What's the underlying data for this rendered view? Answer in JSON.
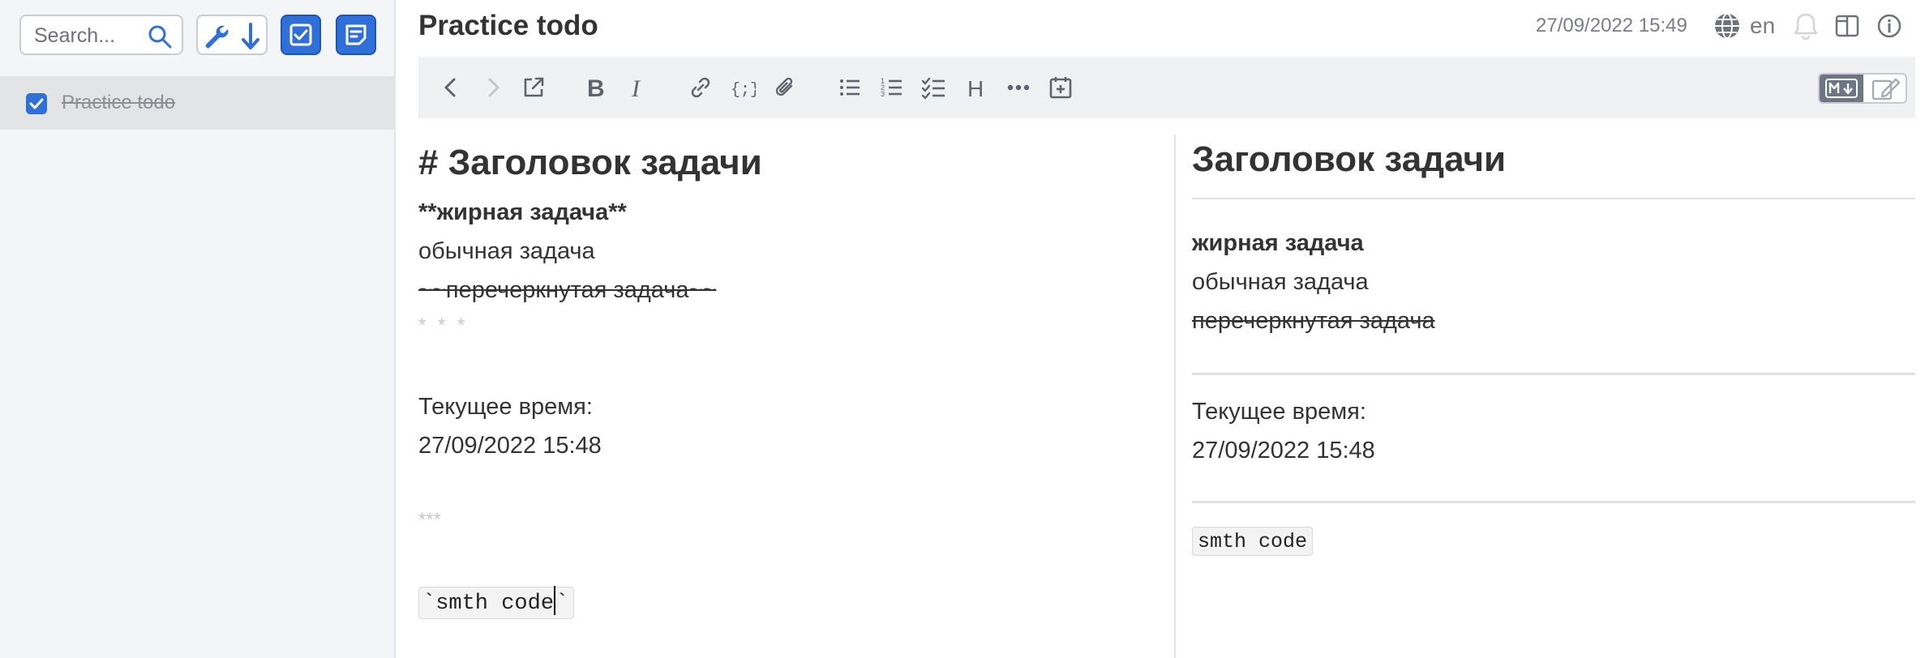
{
  "sidebar": {
    "search": {
      "placeholder": "Search..."
    },
    "todos": [
      {
        "label": "Practice todo",
        "checked": true
      }
    ]
  },
  "header": {
    "title": "Practice todo",
    "datetime": "27/09/2022 15:49",
    "language": "en"
  },
  "editor": {
    "heading": "# Заголовок задачи",
    "bold_line": "**жирная задача**",
    "normal_line": "обычная задача",
    "strike_line": "~~перечеркнутая задача~~",
    "hr1": "* * *",
    "time_label": "Текущее время:",
    "time_value": "27/09/2022 15:48",
    "hr2": "***",
    "code_prefix": "`smth code",
    "code_suffix": "`"
  },
  "preview": {
    "heading": "Заголовок задачи",
    "bold_line": "жирная задача",
    "normal_line": "обычная задача",
    "strike_line": "перечеркнутая задача",
    "time_label": "Текущее время:",
    "time_value": "27/09/2022 15:48",
    "code": "smth code"
  },
  "colors": {
    "accent": "#2f6fd8",
    "icon_gray": "#5f6570",
    "sidebar_bg": "#f4f5f7",
    "toolbar_bg": "#f0f1f3"
  }
}
